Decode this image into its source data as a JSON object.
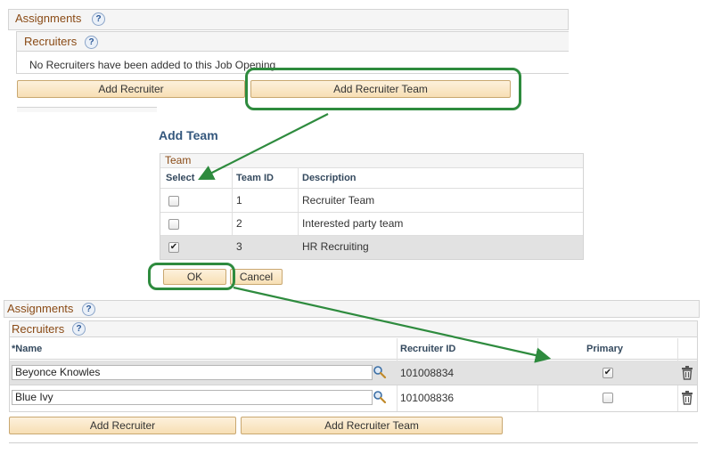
{
  "top": {
    "assignments_title": "Assignments",
    "recruiters_title": "Recruiters",
    "empty_message": "No Recruiters have been added to this Job Opening",
    "add_recruiter": "Add Recruiter",
    "add_recruiter_team": "Add Recruiter Team"
  },
  "dialog": {
    "title": "Add Team",
    "grid_title": "Team",
    "columns": [
      "Select",
      "Team ID",
      "Description"
    ],
    "rows": [
      {
        "id": "1",
        "description": "Recruiter Team",
        "checked": false
      },
      {
        "id": "2",
        "description": "Interested party team",
        "checked": false
      },
      {
        "id": "3",
        "description": "HR Recruiting",
        "checked": true
      }
    ],
    "ok": "OK",
    "cancel": "Cancel"
  },
  "bottom": {
    "assignments_title": "Assignments",
    "recruiters_title": "Recruiters",
    "columns": [
      "*Name",
      "Recruiter ID",
      "Primary"
    ],
    "rows": [
      {
        "name": "Beyonce Knowles",
        "recruiter_id": "101008834",
        "primary": true
      },
      {
        "name": "Blue Ivy",
        "recruiter_id": "101008836",
        "primary": false
      }
    ],
    "add_recruiter": "Add Recruiter",
    "add_recruiter_team": "Add Recruiter Team"
  },
  "help_glyph": "?",
  "check_glyph": "✔",
  "colors": {
    "callout": "#2e8b3e",
    "section_title": "#8a4b16",
    "button": "#f7dfb4"
  }
}
